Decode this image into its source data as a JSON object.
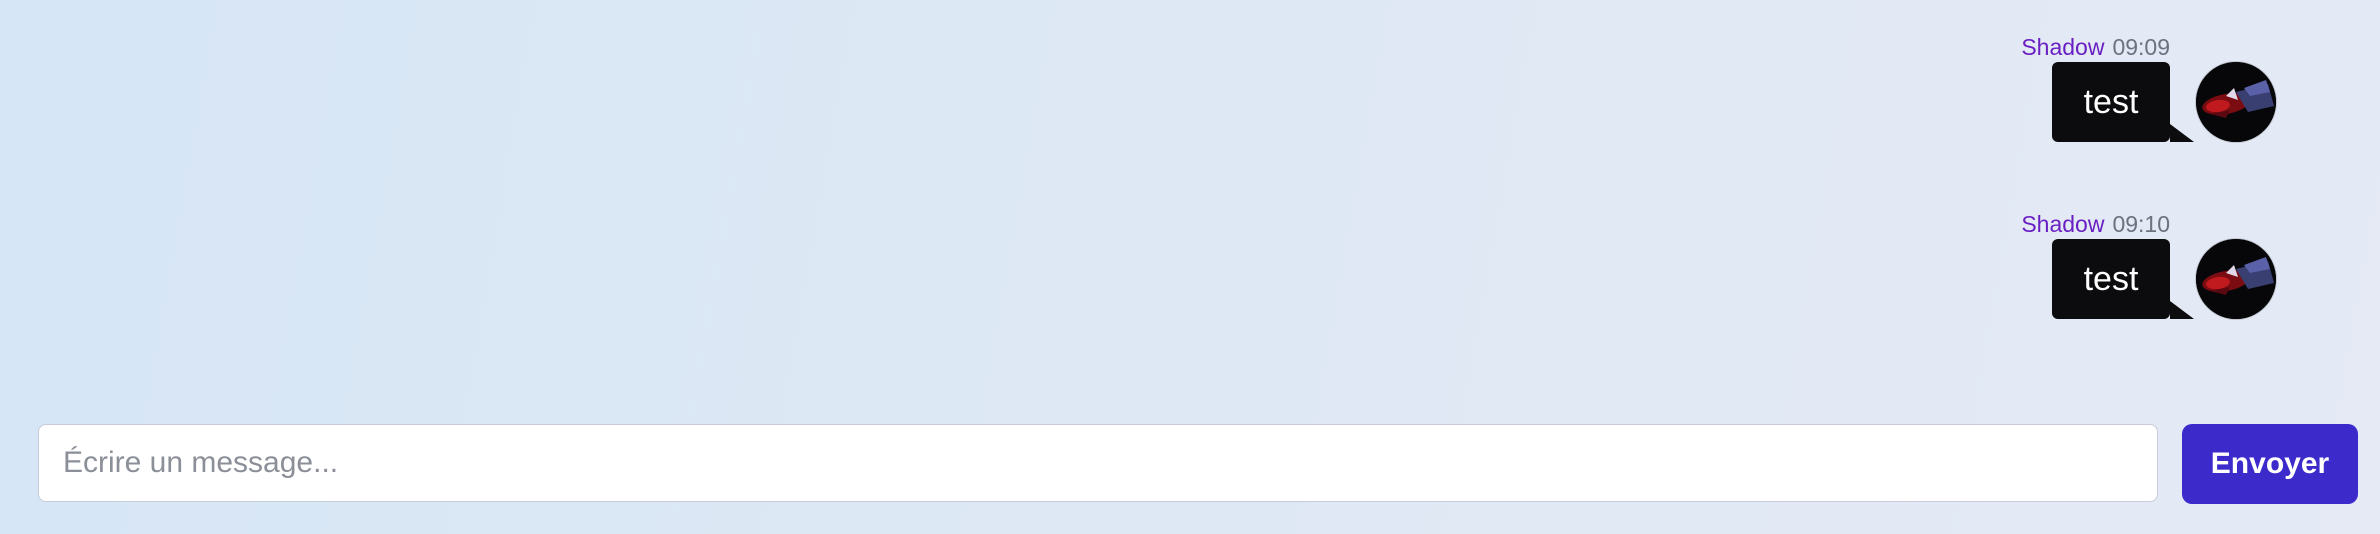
{
  "messages": [
    {
      "author": "Shadow",
      "time": "09:09",
      "text": "test",
      "avatar_icon": "user-avatar-icon"
    },
    {
      "author": "Shadow",
      "time": "09:10",
      "text": "test",
      "avatar_icon": "user-avatar-icon"
    }
  ],
  "composer": {
    "placeholder": "Écrire un message...",
    "value": "",
    "send_label": "Envoyer"
  },
  "colors": {
    "author": "#6a1fc2",
    "time": "#6b7280",
    "bubble": "#0c0c0e",
    "send_button": "#3d2acb"
  }
}
